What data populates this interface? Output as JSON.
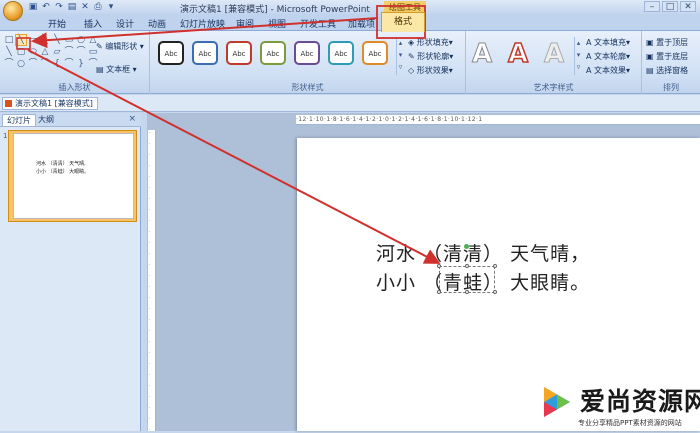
{
  "window": {
    "title": "演示文稿1 [兼容模式] - Microsoft PowerPoint",
    "context_tools": "绘图工具"
  },
  "tabs": [
    "开始",
    "插入",
    "设计",
    "动画",
    "幻灯片放映",
    "审阅",
    "视图",
    "开发工具",
    "加载项"
  ],
  "active_tab": "格式",
  "ribbon": {
    "insert_shapes": {
      "label": "插入形状",
      "edit_shape": "编辑形状",
      "textbox": "文本框",
      "icons": [
        "□",
        "╲",
        "▭",
        "╲",
        "╲",
        "▭",
        "○",
        "△",
        "╲",
        "▢",
        "⬭",
        "△",
        "▱",
        "⌒",
        "⌒",
        "▭",
        "⌒",
        "○",
        "⌒",
        "⌒",
        "{",
        "⌒",
        "}",
        "⌒"
      ]
    },
    "shape_styles": {
      "label": "形状样式",
      "box_text": "Abc",
      "box_colors": [
        "#222222",
        "#3b6db3",
        "#c0392b",
        "#7f9a3c",
        "#6b4b94",
        "#2d9cb4",
        "#e08a2a"
      ],
      "fill": "形状填充",
      "outline": "形状轮廓",
      "effects": "形状效果"
    },
    "wordart": {
      "label": "艺术字样式",
      "letters": [
        "A",
        "A",
        "A"
      ],
      "fill": "文本填充",
      "outline": "文本轮廓",
      "effects": "文本效果"
    },
    "arrange": {
      "label": "排列",
      "front": "置于顶层",
      "back": "置于底层",
      "pane": "选择窗格"
    }
  },
  "document_tab": "演示文稿1 [兼容模式]",
  "left_pane": {
    "tabs": [
      "幻灯片",
      "大纲"
    ],
    "close": "×",
    "slide_number": "1",
    "thumb_line1": "河水 （清清） 天气晴,",
    "thumb_line2": "小小 （青蛙） 大眼睛。"
  },
  "ruler": "·12·1·10·1·8·1·6·1·4·1·2·1·0·1·2·1·4·1·6·1·8·1·10·1·12·1",
  "slide": {
    "line1": "河水 （清清） 天气晴，",
    "line2": "小小 （青蛙） 大眼睛。"
  },
  "watermark": {
    "title": "爱尚资源网",
    "subtitle": "专业分享精品PPT素材资源的网站"
  },
  "colors": {
    "annotation": "#d0312d",
    "accent": "#f3cd68"
  }
}
